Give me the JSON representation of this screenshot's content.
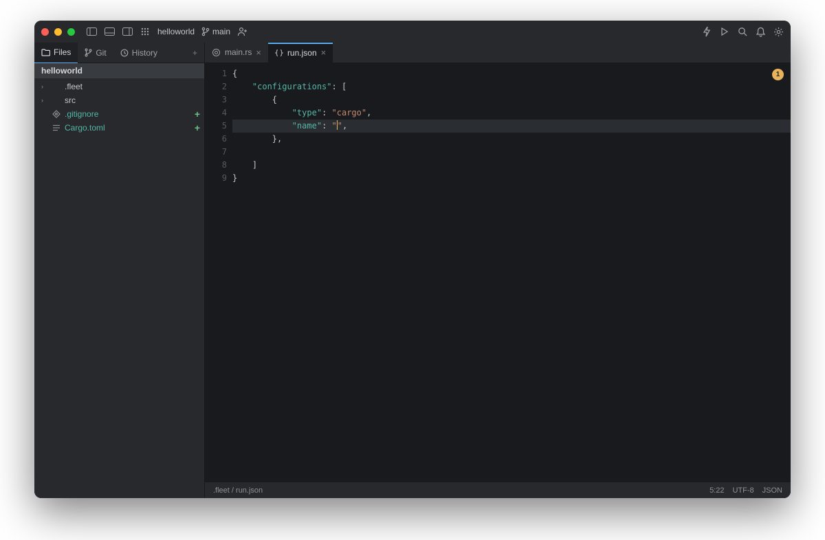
{
  "titlebar": {
    "project": "helloworld",
    "branch": "main"
  },
  "sidebar": {
    "tabs": {
      "files": "Files",
      "git": "Git",
      "history": "History"
    },
    "project_name": "helloworld",
    "tree": [
      {
        "label": ".fleet",
        "kind": "folder",
        "modified": false
      },
      {
        "label": "src",
        "kind": "folder",
        "modified": false
      },
      {
        "label": ".gitignore",
        "kind": "file",
        "modified": true,
        "teal": true
      },
      {
        "label": "Cargo.toml",
        "kind": "file",
        "modified": true,
        "teal": true
      }
    ]
  },
  "editor": {
    "tabs": [
      {
        "label": "main.rs",
        "icon": "rust",
        "active": false
      },
      {
        "label": "run.json",
        "icon": "json",
        "active": true
      }
    ],
    "active_line": 5,
    "code_tokens": [
      [
        {
          "t": "{",
          "c": "punc"
        }
      ],
      [
        {
          "t": "    ",
          "c": "ws"
        },
        {
          "t": "\"configurations\"",
          "c": "key"
        },
        {
          "t": ": [",
          "c": "punc"
        }
      ],
      [
        {
          "t": "        {",
          "c": "punc"
        }
      ],
      [
        {
          "t": "            ",
          "c": "ws"
        },
        {
          "t": "\"type\"",
          "c": "key"
        },
        {
          "t": ": ",
          "c": "punc"
        },
        {
          "t": "\"cargo\"",
          "c": "str"
        },
        {
          "t": ",",
          "c": "punc"
        }
      ],
      [
        {
          "t": "            ",
          "c": "ws"
        },
        {
          "t": "\"name\"",
          "c": "key"
        },
        {
          "t": ": ",
          "c": "punc"
        },
        {
          "t": "\"",
          "c": "str"
        },
        {
          "t": "CURSOR",
          "c": "cursor"
        },
        {
          "t": "\"",
          "c": "str"
        },
        {
          "t": ",",
          "c": "punc"
        }
      ],
      [
        {
          "t": "        },",
          "c": "punc"
        }
      ],
      [
        {
          "t": "",
          "c": "ws"
        }
      ],
      [
        {
          "t": "    ]",
          "c": "punc"
        }
      ],
      [
        {
          "t": "}",
          "c": "punc"
        }
      ]
    ],
    "inspection_count": "1"
  },
  "statusbar": {
    "path_dir": ".fleet",
    "path_sep": " / ",
    "path_file": "run.json",
    "pos": "5:22",
    "encoding": "UTF-8",
    "lang": "JSON"
  }
}
